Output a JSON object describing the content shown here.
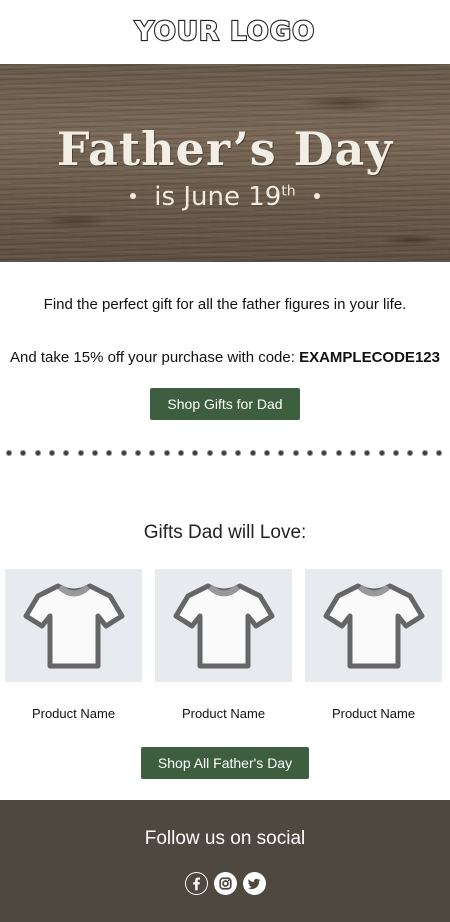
{
  "header": {
    "logo_text": "YOUR LOGO"
  },
  "hero": {
    "title": "Father’s Day",
    "subtitle_main": "is June 19",
    "subtitle_suffix": "th"
  },
  "intro": {
    "line1": "Find the perfect gift for all the father figures in your life.",
    "line2_prefix": "And take 15% off your purchase with code: ",
    "code": "EXAMPLECODE123",
    "cta_label": "Shop Gifts for Dad"
  },
  "gifts": {
    "title": "Gifts Dad will Love:",
    "products": [
      {
        "name": "Product Name",
        "icon": "tshirt-icon"
      },
      {
        "name": "Product Name",
        "icon": "tshirt-icon"
      },
      {
        "name": "Product Name",
        "icon": "tshirt-icon"
      }
    ],
    "cta_label": "Shop All Father's Day"
  },
  "footer": {
    "follow_text": "Follow us on social",
    "icons": [
      "facebook-icon",
      "instagram-icon",
      "twitter-icon"
    ]
  },
  "colors": {
    "button": "#3d5f3f",
    "footer_bg": "#4e4840",
    "product_bg": "#e7eaef"
  }
}
